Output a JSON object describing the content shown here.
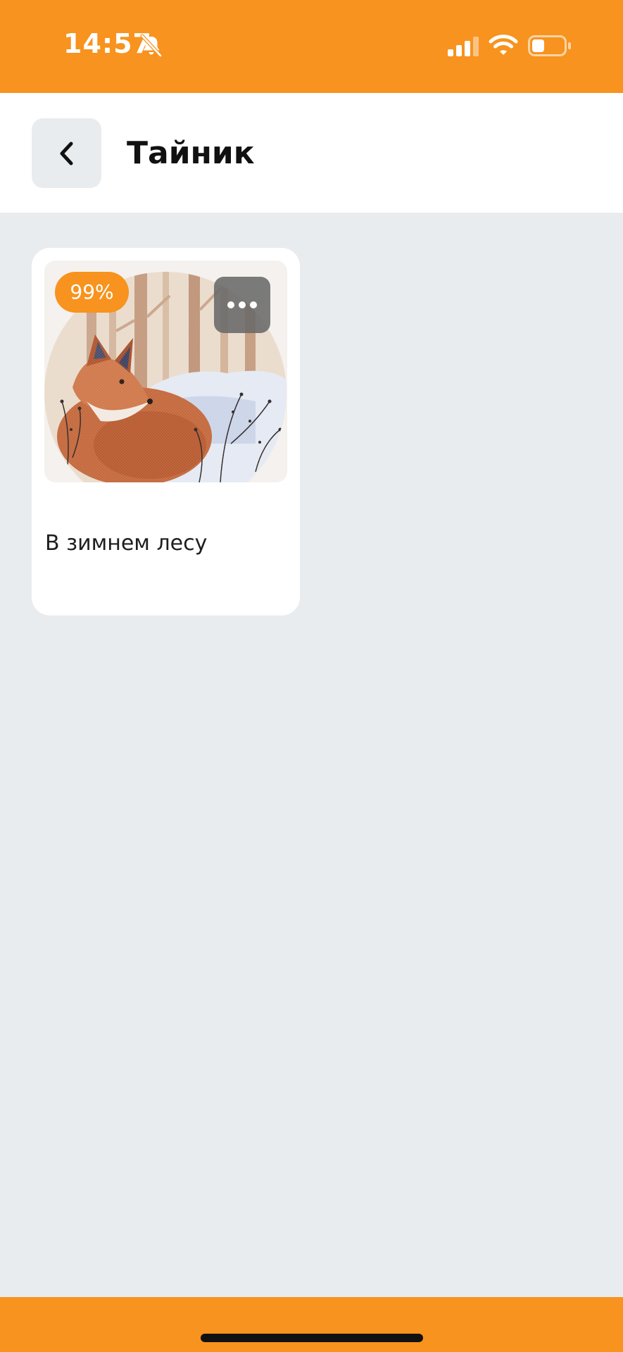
{
  "colors": {
    "accent": "#F7931E",
    "background": "#E9ECEF",
    "card": "#FFFFFF",
    "title_text": "#111111"
  },
  "status_bar": {
    "time": "14:57",
    "icons": [
      "bell-slash-icon",
      "cellular-signal-icon",
      "wifi-icon",
      "battery-icon"
    ]
  },
  "header": {
    "title": "Тайник",
    "back_icon": "chevron-left-icon"
  },
  "cards": [
    {
      "title": "В зимнем лесу",
      "progress_label": "99%",
      "progress": 0.99,
      "image": "fox-in-winter-forest-cross-stitch-pattern",
      "menu_icon": "more-horizontal-icon"
    }
  ]
}
